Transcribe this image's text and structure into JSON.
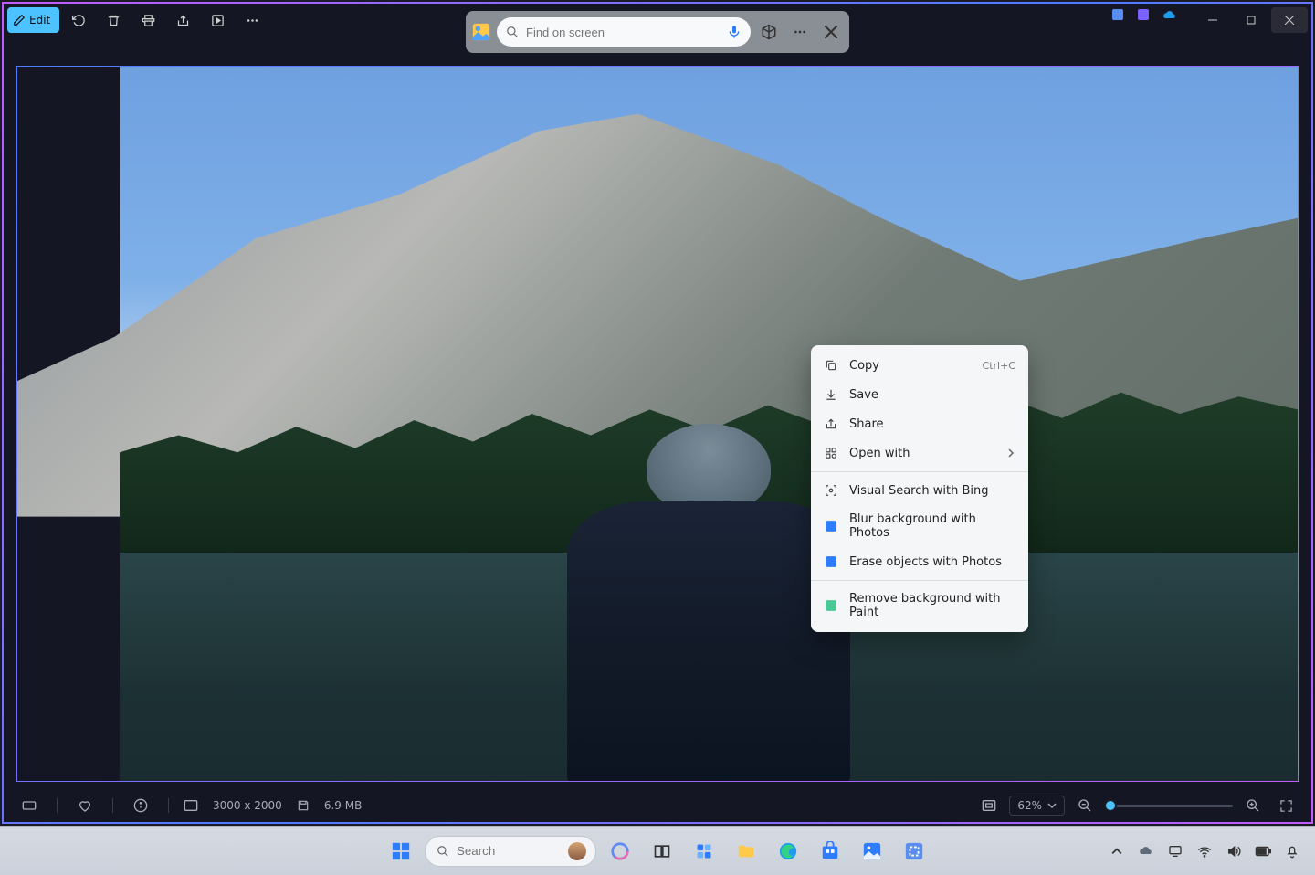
{
  "toolbar": {
    "edit_label": "Edit"
  },
  "search": {
    "placeholder": "Find on screen"
  },
  "context_menu": {
    "copy": "Copy",
    "copy_shortcut": "Ctrl+C",
    "save": "Save",
    "share": "Share",
    "open_with": "Open with",
    "visual_search": "Visual Search with Bing",
    "blur_bg": "Blur background with Photos",
    "erase_objects": "Erase objects with Photos",
    "remove_bg": "Remove background with Paint"
  },
  "status": {
    "dimensions": "3000 x 2000",
    "file_size": "6.9 MB",
    "zoom": "62%"
  },
  "taskbar": {
    "search_placeholder": "Search"
  }
}
